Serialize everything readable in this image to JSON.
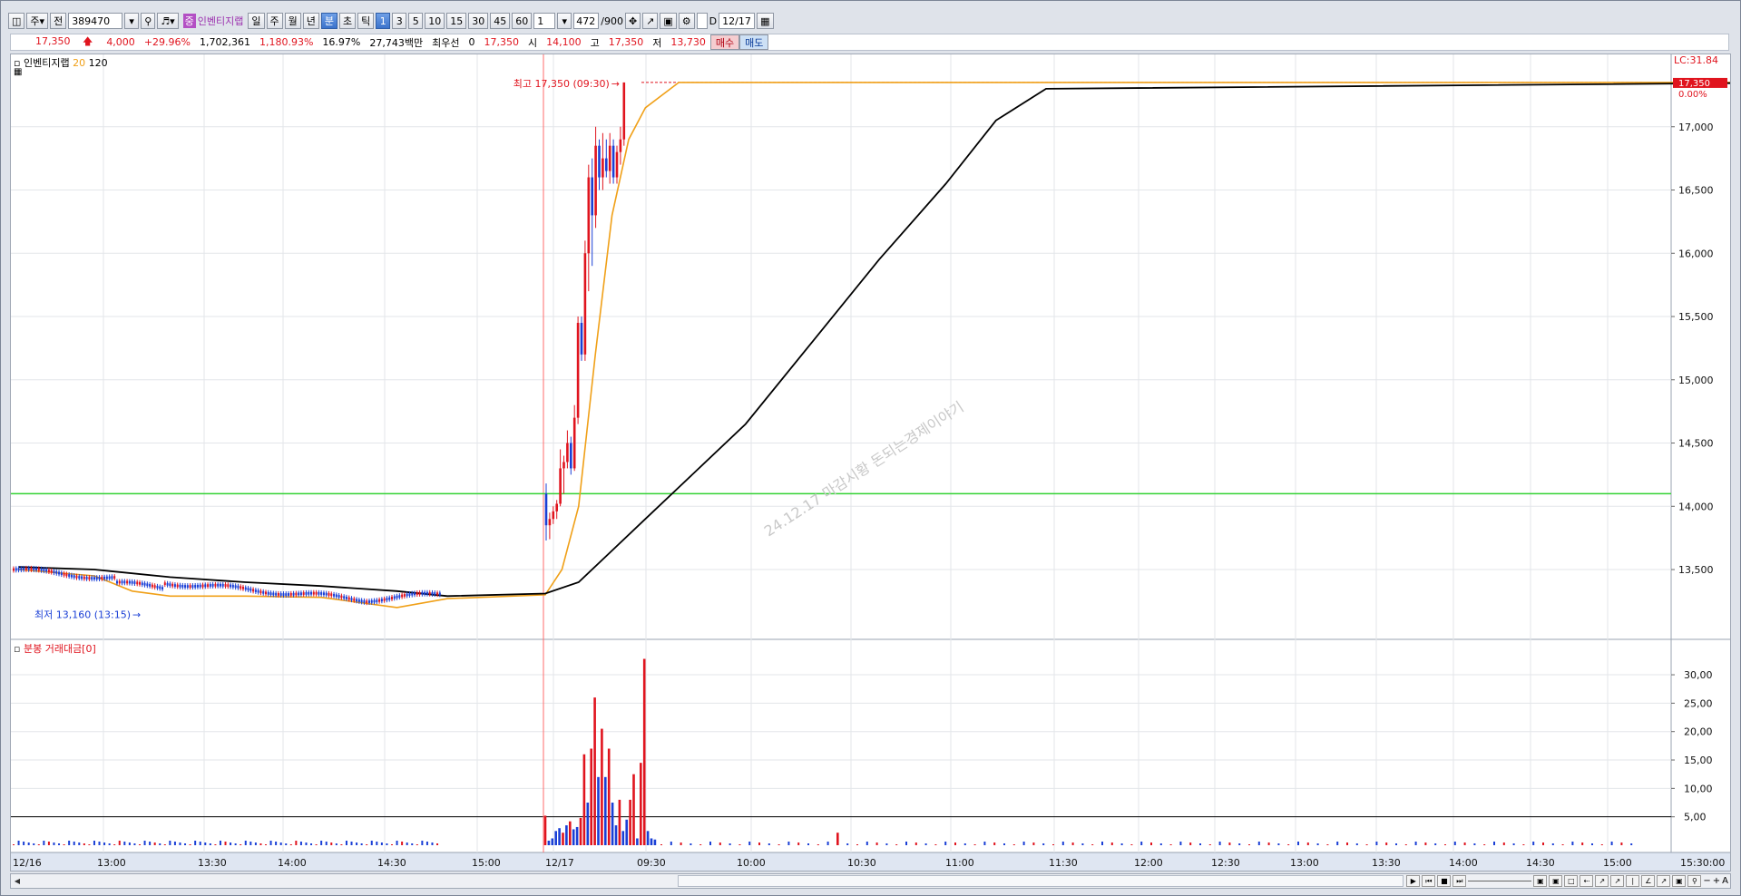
{
  "toolbar": {
    "market_type": "주",
    "prefix": "전",
    "code": "389470",
    "stock_badge": "중",
    "stock_name": "인벤티지랩",
    "periods": [
      "일",
      "주",
      "월",
      "년",
      "분",
      "초",
      "틱"
    ],
    "active_period": "분",
    "intervals": [
      "1",
      "3",
      "5",
      "10",
      "15",
      "30",
      "45",
      "60"
    ],
    "active_interval": "1",
    "interval_select": "1",
    "count": "472",
    "count_total": "/900",
    "date_checkbox_label": "D",
    "date": "12/17"
  },
  "quote": {
    "price": "17,350",
    "change": "4,000",
    "change_pct": "+29.96%",
    "volume": "1,702,361",
    "volume_ratio": "1,180.93%",
    "turnover": "16.97%",
    "amount": "27,743백만",
    "best_bid_label": "최우선",
    "best_bid_value": "0",
    "best_ask": "17,350",
    "open_label": "시",
    "open": "14,100",
    "high_label": "고",
    "high": "17,350",
    "low_label": "저",
    "low": "13,730",
    "buy_label": "매수",
    "sell_label": "매도"
  },
  "colors": {
    "up": "#e0141e",
    "down": "#1a3fd6",
    "ma20": "#f0a018",
    "ma120": "#000000",
    "reference_line": "#32d232",
    "day_divider": "#ff6b6b"
  },
  "price_panel": {
    "legend_name": "인벤티지랩",
    "legend_ma1": "20",
    "legend_ma2": "120",
    "lc_label": "LC:31.84",
    "last_price_tag": "17,350",
    "last_change_tag": "0.00%",
    "high_annotation": "최고 17,350 (09:30)",
    "low_annotation": "최저 13,160 (13:15)",
    "watermark": "24.12.17 마감시황 돈되는경제이야기"
  },
  "volume_panel": {
    "legend": "분봉 거래대금[0]"
  },
  "chart_data": [
    {
      "type": "candlestick",
      "title": "인벤티지랩",
      "x_tick_labels": [
        "12/16",
        "13:00",
        "13:30",
        "14:00",
        "14:30",
        "15:00",
        "12/17",
        "09:30",
        "10:00",
        "10:30",
        "11:00",
        "11:30",
        "12:00",
        "12:30",
        "13:00",
        "13:30",
        "14:00",
        "14:30",
        "15:00",
        "15:30:00"
      ],
      "y_tick_labels": [
        "13,500",
        "14,000",
        "14,500",
        "15,000",
        "15,500",
        "16,000",
        "16,500",
        "17,000"
      ],
      "ylim": [
        13020,
        17500
      ],
      "reference_line": 14100,
      "series": [
        {
          "name": "20",
          "x": [
            "12/16 12:30",
            "12/16 13:00",
            "12/16 13:15",
            "12/16 13:30",
            "12/16 14:00",
            "12/16 14:30",
            "12/16 14:45",
            "12/16 15:00",
            "12/16 15:20",
            "12/17 09:00",
            "12/17 09:05",
            "12/17 09:10",
            "12/17 09:15",
            "12/17 09:20",
            "12/17 09:25",
            "12/17 09:30",
            "12/17 09:40",
            "12/17 15:20"
          ],
          "values": [
            13500,
            13450,
            13330,
            13290,
            13290,
            13280,
            13240,
            13200,
            13270,
            13300,
            13500,
            14000,
            15200,
            16300,
            16900,
            17150,
            17350,
            17350
          ]
        },
        {
          "name": "120",
          "x": [
            "12/16 12:30",
            "12/16 13:00",
            "12/16 13:30",
            "12/16 14:00",
            "12/16 14:30",
            "12/16 15:00",
            "12/16 15:20",
            "12/17 09:00",
            "12/17 09:10",
            "12/17 09:20",
            "12/17 09:30",
            "12/17 09:40",
            "12/17 10:00",
            "12/17 10:20",
            "12/17 10:40",
            "12/17 11:00",
            "12/17 11:15",
            "12/17 11:30",
            "12/17 15:20"
          ],
          "values": [
            13520,
            13500,
            13440,
            13400,
            13370,
            13330,
            13290,
            13310,
            13400,
            13650,
            13900,
            14150,
            14650,
            15300,
            15950,
            16550,
            17050,
            17300,
            17350
          ]
        }
      ],
      "candles_sample": [
        {
          "time": "12/17 09:00",
          "open": 14100,
          "high": 14180,
          "low": 13730,
          "close": 13850
        },
        {
          "time": "12/17 09:05",
          "open": 14000,
          "high": 14450,
          "low": 13950,
          "close": 14300
        },
        {
          "time": "12/17 09:10",
          "open": 14700,
          "high": 15500,
          "low": 14600,
          "close": 15400
        },
        {
          "time": "12/17 09:15",
          "open": 15600,
          "high": 16700,
          "low": 15600,
          "close": 16600
        },
        {
          "time": "12/17 09:20",
          "open": 16600,
          "high": 17000,
          "low": 16300,
          "close": 16750
        },
        {
          "time": "12/17 09:25",
          "open": 16600,
          "high": 16900,
          "low": 16500,
          "close": 16800
        },
        {
          "time": "12/17 09:30",
          "open": 16900,
          "high": 17350,
          "low": 16850,
          "close": 17350
        }
      ],
      "high": {
        "value": 17350,
        "time": "09:30"
      },
      "low": {
        "value": 13160,
        "time": "13:15"
      }
    },
    {
      "type": "bar",
      "title": "분봉 거래대금[0]",
      "y_tick_labels": [
        "5,00",
        "10,00",
        "15,00",
        "20,00",
        "25,00",
        "30,00"
      ],
      "ylim": [
        0,
        34
      ],
      "reference_line": 5,
      "x": [
        "12/17 09:00",
        "12/17 09:01",
        "12/17 09:02",
        "12/17 09:03",
        "12/17 09:04",
        "12/17 09:05",
        "12/17 09:06",
        "12/17 09:07",
        "12/17 09:08",
        "12/17 09:09",
        "12/17 09:10",
        "12/17 09:11",
        "12/17 09:12",
        "12/17 09:13",
        "12/17 09:14",
        "12/17 09:15",
        "12/17 09:16",
        "12/17 09:17",
        "12/17 09:18",
        "12/17 09:19",
        "12/17 09:20",
        "12/17 09:21",
        "12/17 09:22",
        "12/17 09:23",
        "12/17 09:24",
        "12/17 09:25",
        "12/17 09:26",
        "12/17 09:27",
        "12/17 09:28",
        "12/17 09:29",
        "12/17 09:30",
        "12/17 09:31"
      ],
      "values": [
        5.2,
        0.8,
        1.2,
        2.5,
        3.0,
        2.2,
        3.5,
        4.2,
        2.8,
        3.2,
        4.8,
        16,
        7.5,
        17,
        26,
        12,
        20.5,
        12,
        17,
        7.5,
        3.5,
        8,
        2.5,
        4.5,
        8,
        12.5,
        1.2,
        14.5,
        32.8,
        2.5,
        1.2,
        1.0
      ],
      "direction": [
        "up",
        "down",
        "down",
        "down",
        "down",
        "up",
        "down",
        "up",
        "down",
        "down",
        "up",
        "up",
        "down",
        "up",
        "up",
        "down",
        "up",
        "down",
        "up",
        "down",
        "down",
        "up",
        "down",
        "down",
        "up",
        "up",
        "down",
        "up",
        "up",
        "down",
        "down",
        "down"
      ]
    }
  ]
}
